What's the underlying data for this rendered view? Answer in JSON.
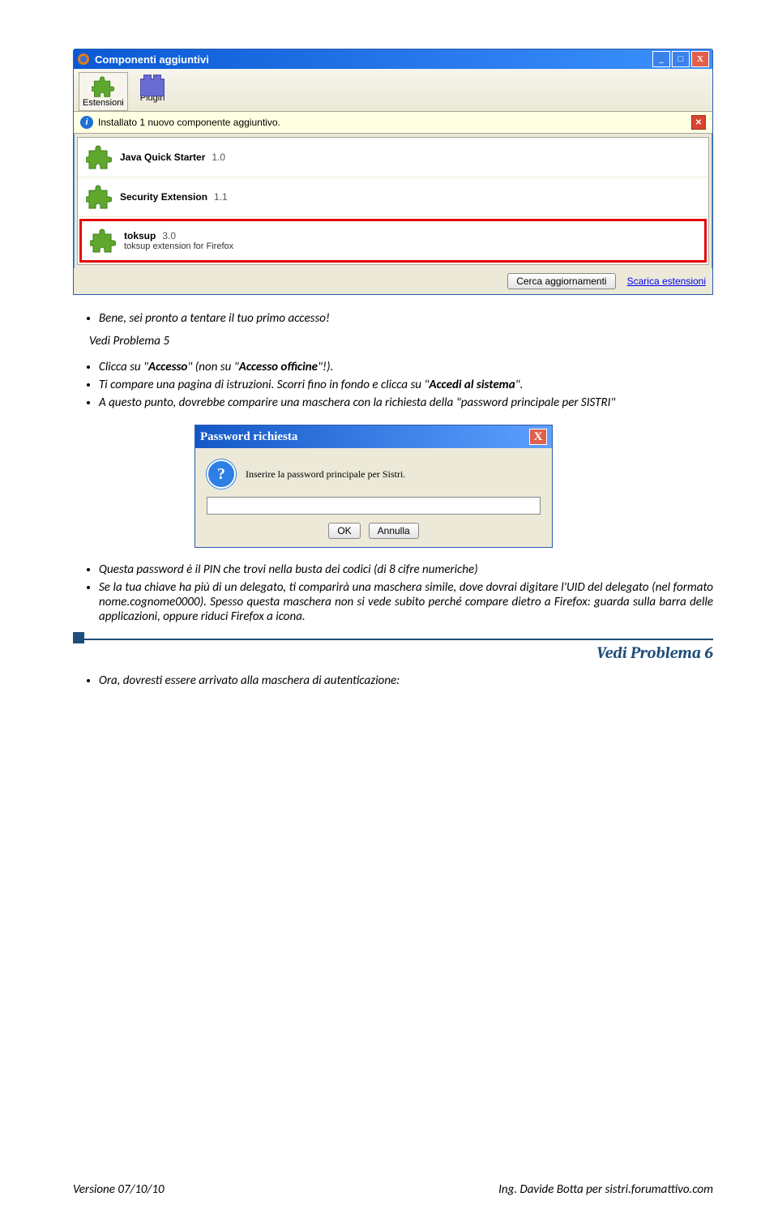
{
  "win1": {
    "title": "Componenti aggiuntivi",
    "tabs": {
      "ext": "Estensioni",
      "plugin": "Plugin"
    },
    "infobar": "Installato 1 nuovo componente aggiuntivo.",
    "items": [
      {
        "name": "Java Quick Starter",
        "ver": "1.0",
        "desc": ""
      },
      {
        "name": "Security Extension",
        "ver": "1.1",
        "desc": ""
      },
      {
        "name": "toksup",
        "ver": "3.0",
        "desc": "toksup extension for Firefox"
      }
    ],
    "btn_updates": "Cerca aggiornamenti",
    "link_download": "Scarica estensioni"
  },
  "body1": {
    "b1": "Bene, sei pronto a tentare il tuo primo accesso!",
    "vp5": "Vedi Problema 5",
    "b2a": "Clicca su \"",
    "b2b": "Accesso",
    "b2c": "\" (non su \"",
    "b2d": "Accesso officine",
    "b2e": "\"!).",
    "b3": "Ti compare una pagina di istruzioni. Scorri fino in fondo e clicca su \"",
    "b3b": "Accedi al sistema",
    "b3c": "\".",
    "b4": "A questo punto, dovrebbe comparire una maschera con la richiesta della \"password principale per SISTRI\""
  },
  "dlg": {
    "title": "Password richiesta",
    "msg": "Inserire la password principale per Sistri.",
    "ok": "OK",
    "cancel": "Annulla"
  },
  "body2": {
    "b1": "Questa password è il PIN che trovi nella busta dei codici (di 8 cifre numeriche)",
    "b2": "Se la tua chiave ha più di un delegato, ti comparirà una maschera simile, dove dovrai digitare l'UID del delegato (nel formato nome.cognome0000). Spesso questa maschera non si vede subito perché compare dietro a Firefox: guarda sulla barra delle applicazioni, oppure riduci Firefox a icona.",
    "b3": "Ora, dovresti essere arrivato alla maschera di autenticazione:"
  },
  "vp6": "Vedi Problema 6",
  "footer": {
    "left": "Versione 07/10/10",
    "right": "Ing. Davide Botta per sistri.forumattivo.com"
  }
}
